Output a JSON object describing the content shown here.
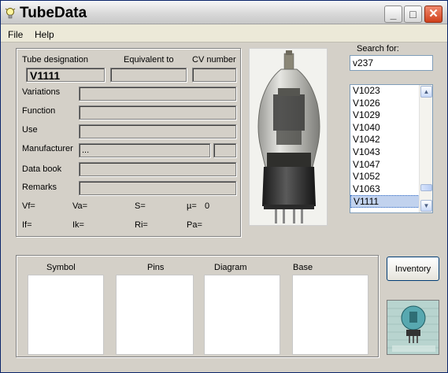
{
  "window": {
    "title": "TubeData",
    "minimize": "_",
    "maximize": "□",
    "close": "✕"
  },
  "menu": {
    "file": "File",
    "help": "Help"
  },
  "tube": {
    "header_designation": "Tube designation",
    "header_equivalent": "Equivalent to",
    "header_cv": "CV number",
    "designation": "V1111",
    "equivalent": "",
    "cv_number": "",
    "labels": {
      "variations": "Variations",
      "function": "Function",
      "use": "Use",
      "manufacturer": "Manufacturer",
      "data_book": "Data book",
      "remarks": "Remarks"
    },
    "values": {
      "variations": "",
      "function": "",
      "use": "",
      "manufacturer": "...",
      "manufacturer_extra": "",
      "data_book": "",
      "remarks": ""
    },
    "params_row1": {
      "vf": "Vf=",
      "va": "Va=",
      "s": "S=",
      "mu": "µ=",
      "mu_value": "0"
    },
    "params_row2": {
      "if": "If=",
      "ik": "Ik=",
      "ri": "Ri=",
      "pa": "Pa="
    }
  },
  "search": {
    "label": "Search for:",
    "value": "v237",
    "results": [
      "V1023",
      "V1026",
      "V1029",
      "V1040",
      "V1042",
      "V1043",
      "V1047",
      "V1052",
      "V1063",
      "V1111"
    ],
    "selected": "V1111"
  },
  "bottom_panel": {
    "symbol": "Symbol",
    "pins": "Pins",
    "diagram": "Diagram",
    "base": "Base"
  },
  "inventory_button": "Inventory",
  "icons": [
    "bulb-icon",
    "scroll-up-icon",
    "scroll-down-icon"
  ]
}
